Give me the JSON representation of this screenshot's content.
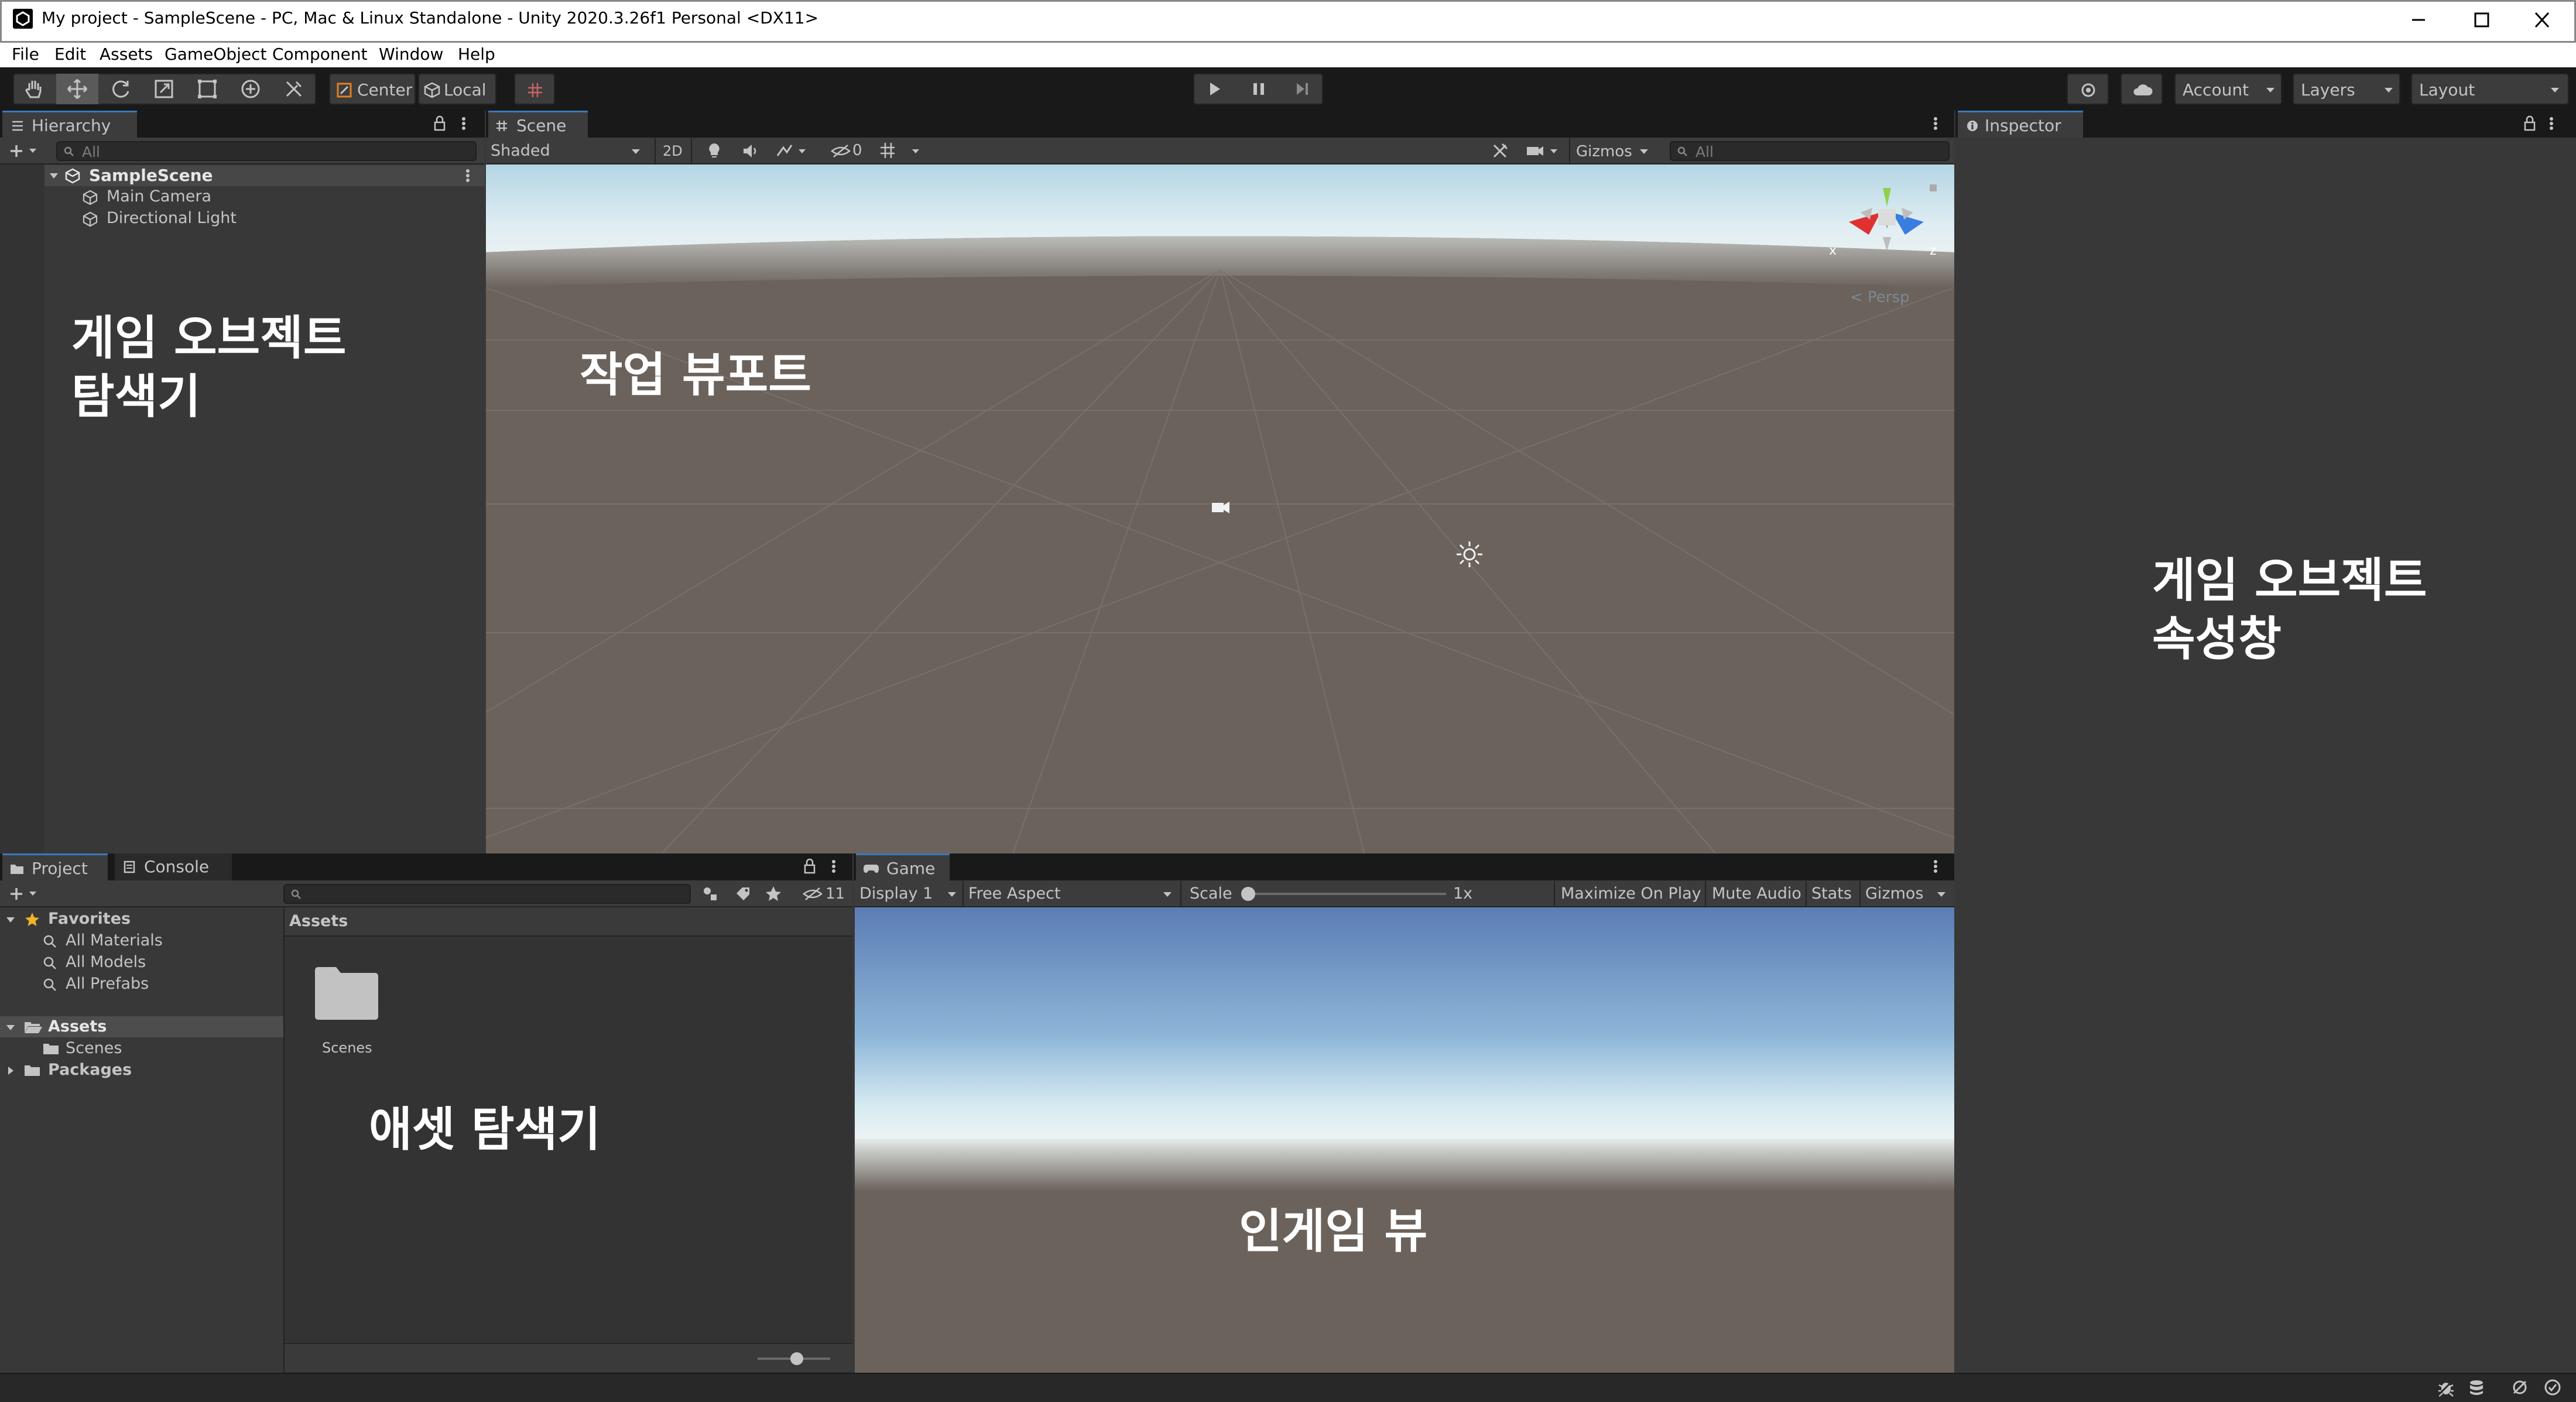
{
  "window": {
    "title": "My project - SampleScene - PC, Mac & Linux Standalone - Unity 2020.3.26f1 Personal <DX11>"
  },
  "menu": {
    "items": [
      "File",
      "Edit",
      "Assets",
      "GameObject",
      "Component",
      "Window",
      "Help"
    ]
  },
  "toolbar": {
    "center_label": "Center",
    "local_label": "Local",
    "account_label": "Account",
    "layers_label": "Layers",
    "layout_label": "Layout"
  },
  "hierarchy": {
    "tab_label": "Hierarchy",
    "search_placeholder": "All",
    "scene_name": "SampleScene",
    "items": [
      "Main Camera",
      "Directional Light"
    ]
  },
  "scene": {
    "tab_label": "Scene",
    "shading_mode": "Shaded",
    "mode_2d": "2D",
    "hidden_count": "0",
    "gizmos_label": "Gizmos",
    "search_placeholder": "All",
    "persp_label": "< Persp",
    "axis_x": "x",
    "axis_z": "z"
  },
  "inspector": {
    "tab_label": "Inspector"
  },
  "project": {
    "tab_label": "Project",
    "console_tab_label": "Console",
    "hidden_count": "11",
    "favorites_label": "Favorites",
    "favorites": [
      "All Materials",
      "All Models",
      "All Prefabs"
    ],
    "assets_label": "Assets",
    "assets_children": [
      "Scenes"
    ],
    "packages_label": "Packages",
    "breadcrumb": "Assets",
    "folder_name": "Scenes"
  },
  "game": {
    "tab_label": "Game",
    "display": "Display 1",
    "aspect": "Free Aspect",
    "scale_label": "Scale",
    "scale_value": "1x",
    "maximize_on_play": "Maximize On Play",
    "mute_audio": "Mute Audio",
    "stats": "Stats",
    "gizmos": "Gizmos"
  },
  "annotations": {
    "hierarchy_line1": "게임 오브젝트",
    "hierarchy_line2": "탐색기",
    "scene": "작업 뷰포트",
    "inspector_line1": "게임 오브젝트",
    "inspector_line2": "속성창",
    "project": "애셋 탐색기",
    "game": "인게임 뷰"
  },
  "colors": {
    "accent": "#3a79bb",
    "editor_bg": "#383838",
    "toolbar_bg": "#191919",
    "scene_ground": "#6b625c",
    "sky_top": "#b9d6e4",
    "game_sky_top": "#5a7db4"
  }
}
